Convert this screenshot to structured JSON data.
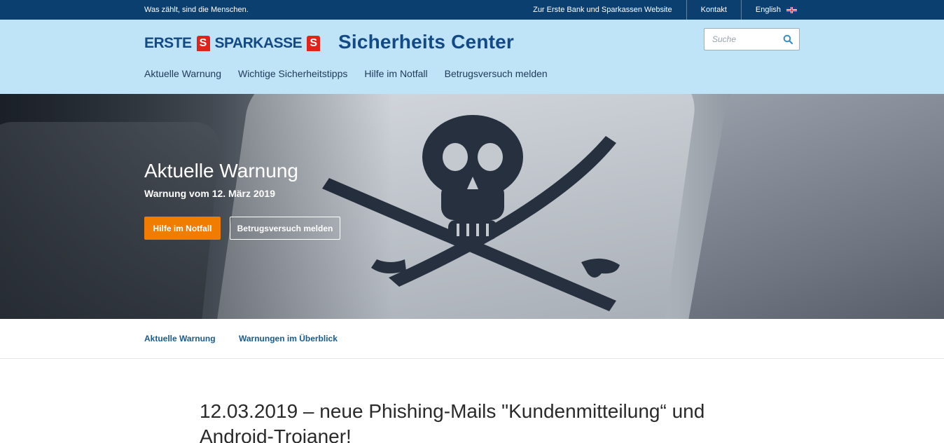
{
  "topbar": {
    "tagline": "Was zählt, sind die Menschen.",
    "links": [
      "Zur Erste Bank und Sparkassen Website",
      "Kontakt"
    ],
    "language": "English"
  },
  "header": {
    "logo_word_1": "ERSTE",
    "logo_word_2": "SPARKASSE",
    "logo_mark": "S",
    "site_title": "Sicherheits Center",
    "search_placeholder": "Suche",
    "nav": [
      "Aktuelle Warnung",
      "Wichtige Sicherheitstipps",
      "Hilfe im Notfall",
      "Betrugsversuch melden"
    ]
  },
  "hero": {
    "title": "Aktuelle Warnung",
    "subtitle": "Warnung vom 12. März 2019",
    "primary_button": "Hilfe im Notfall",
    "secondary_button": "Betrugsversuch melden",
    "image_icon": "pirate-skull-icon"
  },
  "subnav": [
    "Aktuelle Warnung",
    "Warnungen im Überblick"
  ],
  "article": {
    "title": "12.03.2019 – neue Phishing-Mails \"Kundenmitteilung“ und Android-Trojaner!"
  },
  "colors": {
    "topbar": "#0a3f70",
    "header": "#bfe3f7",
    "brand_blue": "#134a86",
    "accent_orange": "#f07d00",
    "logo_red": "#e2231a"
  }
}
